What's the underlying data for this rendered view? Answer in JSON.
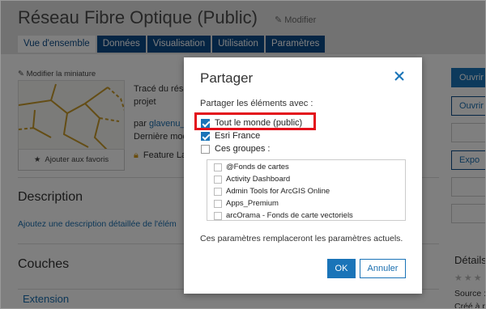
{
  "item": {
    "title": "Réseau Fibre Optique (Public)",
    "edit_label": "Modifier"
  },
  "tabs": [
    {
      "label": "Vue d'ensemble",
      "active": true
    },
    {
      "label": "Données",
      "active": false
    },
    {
      "label": "Visualisation",
      "active": false
    },
    {
      "label": "Utilisation",
      "active": false
    },
    {
      "label": "Paramètres",
      "active": false
    }
  ],
  "overview": {
    "edit_thumbnail": "Modifier la miniature",
    "add_favorite": "Ajouter aux favoris",
    "summary_line1": "Tracé du rése",
    "summary_line2": "projet",
    "owner_prefix": "par ",
    "owner_name": "glavenu_",
    "modified_prefix": "Dernière mod",
    "feature_type": "Feature La",
    "description_heading": "Description",
    "description_link": "Ajoutez une description détaillée de l'élém",
    "layers_heading": "Couches",
    "layer_name": "Extension"
  },
  "right_panel": {
    "open_primary": "Ouvrir",
    "open_secondary": "Ouvrir",
    "export": "Expo",
    "details_heading": "Détails",
    "stars": "★★★",
    "source_label": "Source :",
    "created_label": "Créé à p"
  },
  "dialog": {
    "title": "Partager",
    "share_with_label": "Partager les éléments avec :",
    "options": [
      {
        "label": "Tout le monde (public)",
        "checked": true
      },
      {
        "label": "Esri France",
        "checked": true
      },
      {
        "label": "Ces groupes :",
        "checked": false
      }
    ],
    "groups": [
      {
        "label": "@Fonds de cartes",
        "checked": false
      },
      {
        "label": "Activity Dashboard",
        "checked": false
      },
      {
        "label": "Admin Tools for ArcGIS Online",
        "checked": false
      },
      {
        "label": "Apps_Premium",
        "checked": false
      },
      {
        "label": "arcOrama - Fonds de carte vectoriels",
        "checked": false
      }
    ],
    "note": "Ces paramètres remplaceront les paramètres actuels.",
    "ok_label": "OK",
    "cancel_label": "Annuler",
    "highlight_color": "#e3101a"
  },
  "colors": {
    "brand_blue": "#0b4b88",
    "accent_blue": "#1a74b8",
    "link_blue": "#1a6fb0",
    "overlay": "rgba(0,0,0,0.5)"
  },
  "icons": {
    "edit": "pencil-icon",
    "close": "close-icon",
    "favorite": "star-icon",
    "feature_layer": "lock-icon"
  }
}
